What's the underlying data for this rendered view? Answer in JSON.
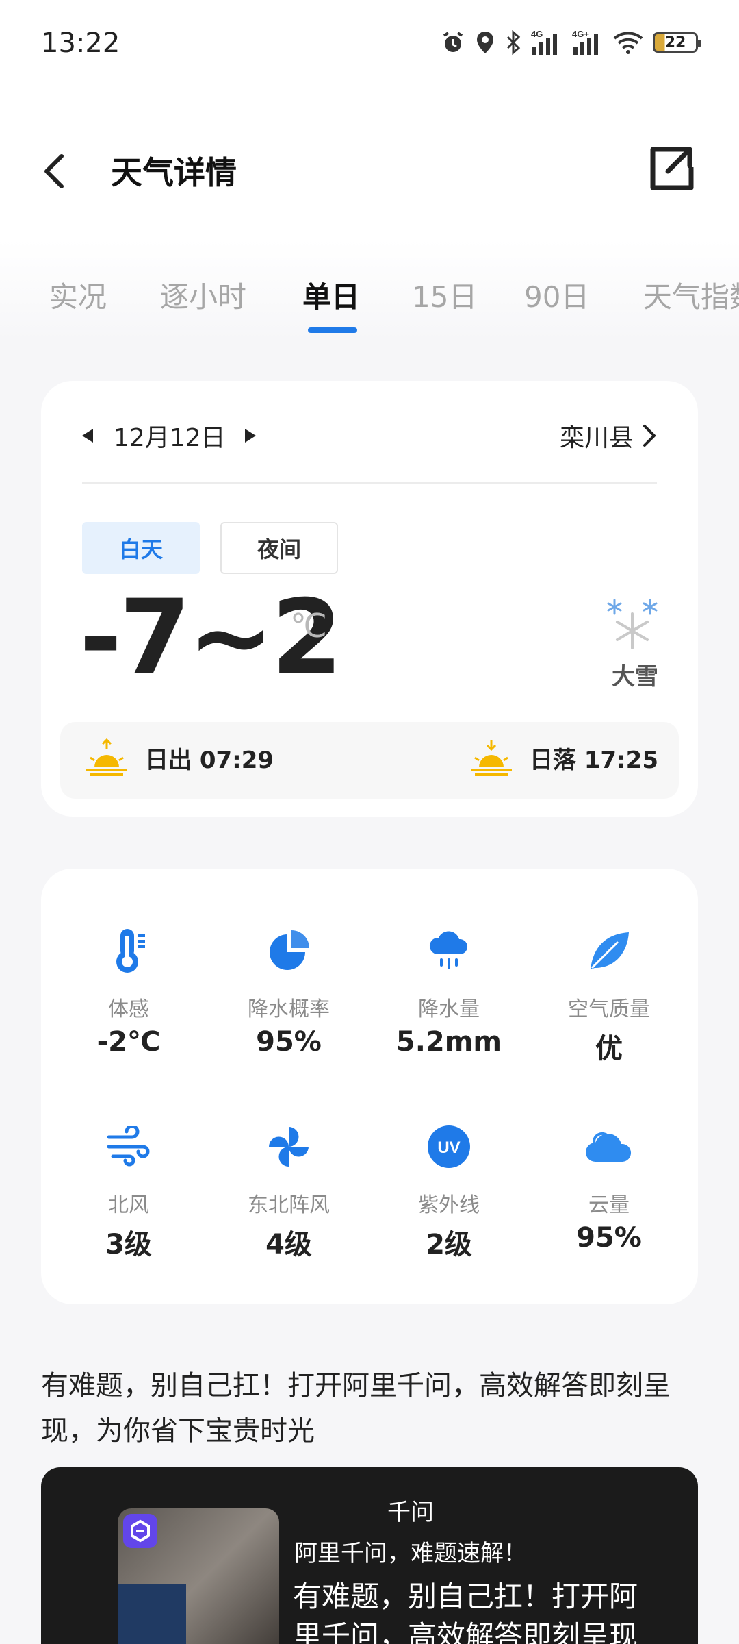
{
  "status_bar": {
    "time": "13:22",
    "battery": "22"
  },
  "header": {
    "title": "天气详情"
  },
  "tabs": [
    "实况",
    "逐小时",
    "单日",
    "15日",
    "90日",
    "天气指数"
  ],
  "active_tab": "单日",
  "day_card": {
    "date": "12月12日",
    "location": "栾川县",
    "segments": {
      "day": "白天",
      "night": "夜间"
    },
    "temperature": "-7~2",
    "unit": "℃",
    "weather": "大雪",
    "sunrise": "日出 07:29",
    "sunset": "日落 17:25"
  },
  "metrics": [
    {
      "label": "体感",
      "value": "-2℃",
      "icon": "thermometer-icon"
    },
    {
      "label": "降水概率",
      "value": "95%",
      "icon": "pie-icon"
    },
    {
      "label": "降水量",
      "value": "5.2mm",
      "icon": "rain-cloud-icon"
    },
    {
      "label": "空气质量",
      "value": "优",
      "icon": "leaf-icon"
    },
    {
      "label": "北风",
      "value": "3级",
      "icon": "wind-icon"
    },
    {
      "label": "东北阵风",
      "value": "4级",
      "icon": "pinwheel-icon"
    },
    {
      "label": "紫外线",
      "value": "2级",
      "icon": "uv-icon"
    },
    {
      "label": "云量",
      "value": "95%",
      "icon": "cloud-icon"
    }
  ],
  "promo": {
    "text": "有难题，别自己扛！打开阿里千问，高效解答即刻呈现，为你省下宝贵时光",
    "app_name": "千问",
    "subtitle": "阿里千问，难题速解！",
    "headline": "有难题，别自己扛！打开阿里千问，高效解答即刻呈现"
  },
  "colors": {
    "accent": "#1f7ae8",
    "sun": "#f5b800"
  }
}
